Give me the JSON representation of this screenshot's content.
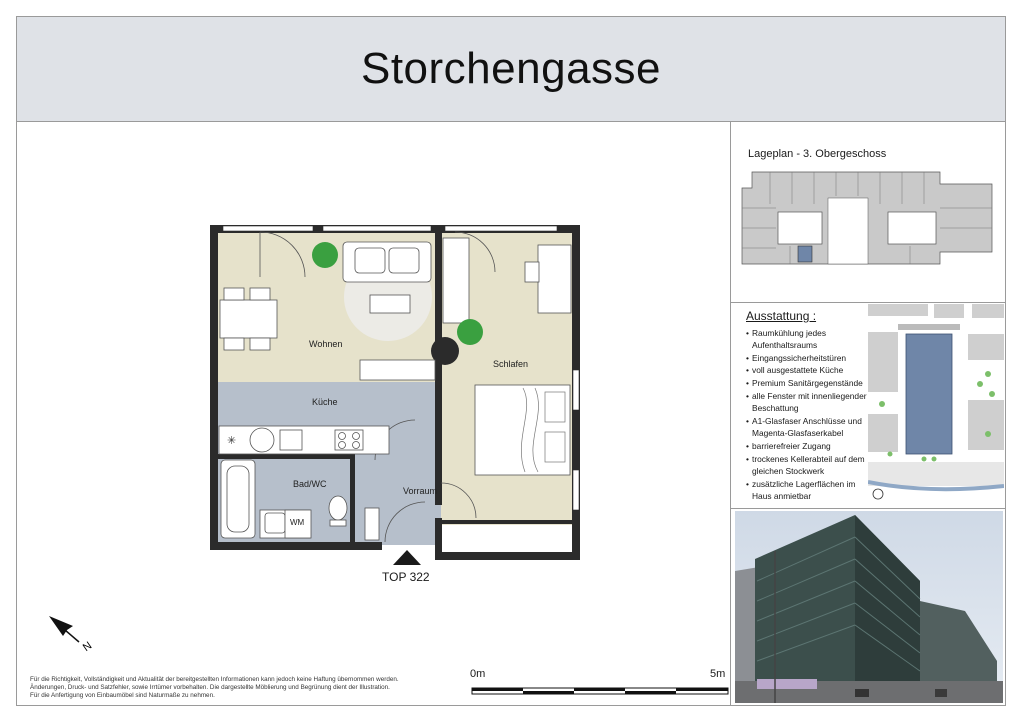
{
  "header": {
    "title": "Storchengasse"
  },
  "floorplan": {
    "rooms": {
      "wohnen": "Wohnen",
      "schlafen": "Schlafen",
      "kueche": "Küche",
      "bad": "Bad/WC",
      "vorraum": "Vorraum",
      "wm": "WM"
    },
    "unit_label": "TOP 322"
  },
  "lageplan": {
    "title": "Lageplan - 3. Obergeschoss"
  },
  "amenities": {
    "title": "Ausstattung :",
    "items": [
      "Raumkühlung jedes",
      "Aufenthaltsraums",
      "Eingangssicherheitstüren",
      "voll ausgestattete Küche",
      "Premium Sanitärgegenstände",
      "alle Fenster mit innenliegender",
      "Beschattung",
      "A1-Glasfaser Anschlüsse und",
      "Magenta-Glasfaserkabel",
      "barrierefreier Zugang",
      "trockenes Kellerabteil auf dem",
      "gleichen Stockwerk",
      "zusätzliche Lagerflächen im",
      "Haus anmietbar"
    ],
    "bulleted": [
      true,
      false,
      true,
      true,
      true,
      true,
      false,
      true,
      false,
      true,
      true,
      false,
      true,
      false
    ]
  },
  "north_arrow": {
    "label": "N"
  },
  "scale_bar": {
    "start_label": "0m",
    "end_label": "5m"
  },
  "disclaimer": {
    "lines": [
      "Für die Richtigkeit, Vollständigkeit und Aktualität der bereitgestellten Informationen kann jedoch keine Haftung übernommen werden.",
      "Änderungen, Druck- und Satzfehler, sowie Irrtümer vorbehalten. Die dargestellte Möblierung und Begrünung dient der Illustration.",
      "Für die Anfertigung von Einbaumöbel sind Naturmaße zu nehmen."
    ]
  },
  "colors": {
    "header_bg": "#dfe2e7",
    "wall": "#2b2b2b",
    "living_floor": "#e6e2cb",
    "wet_floor": "#b6bfcb",
    "building_blue": "#6f86a8"
  }
}
